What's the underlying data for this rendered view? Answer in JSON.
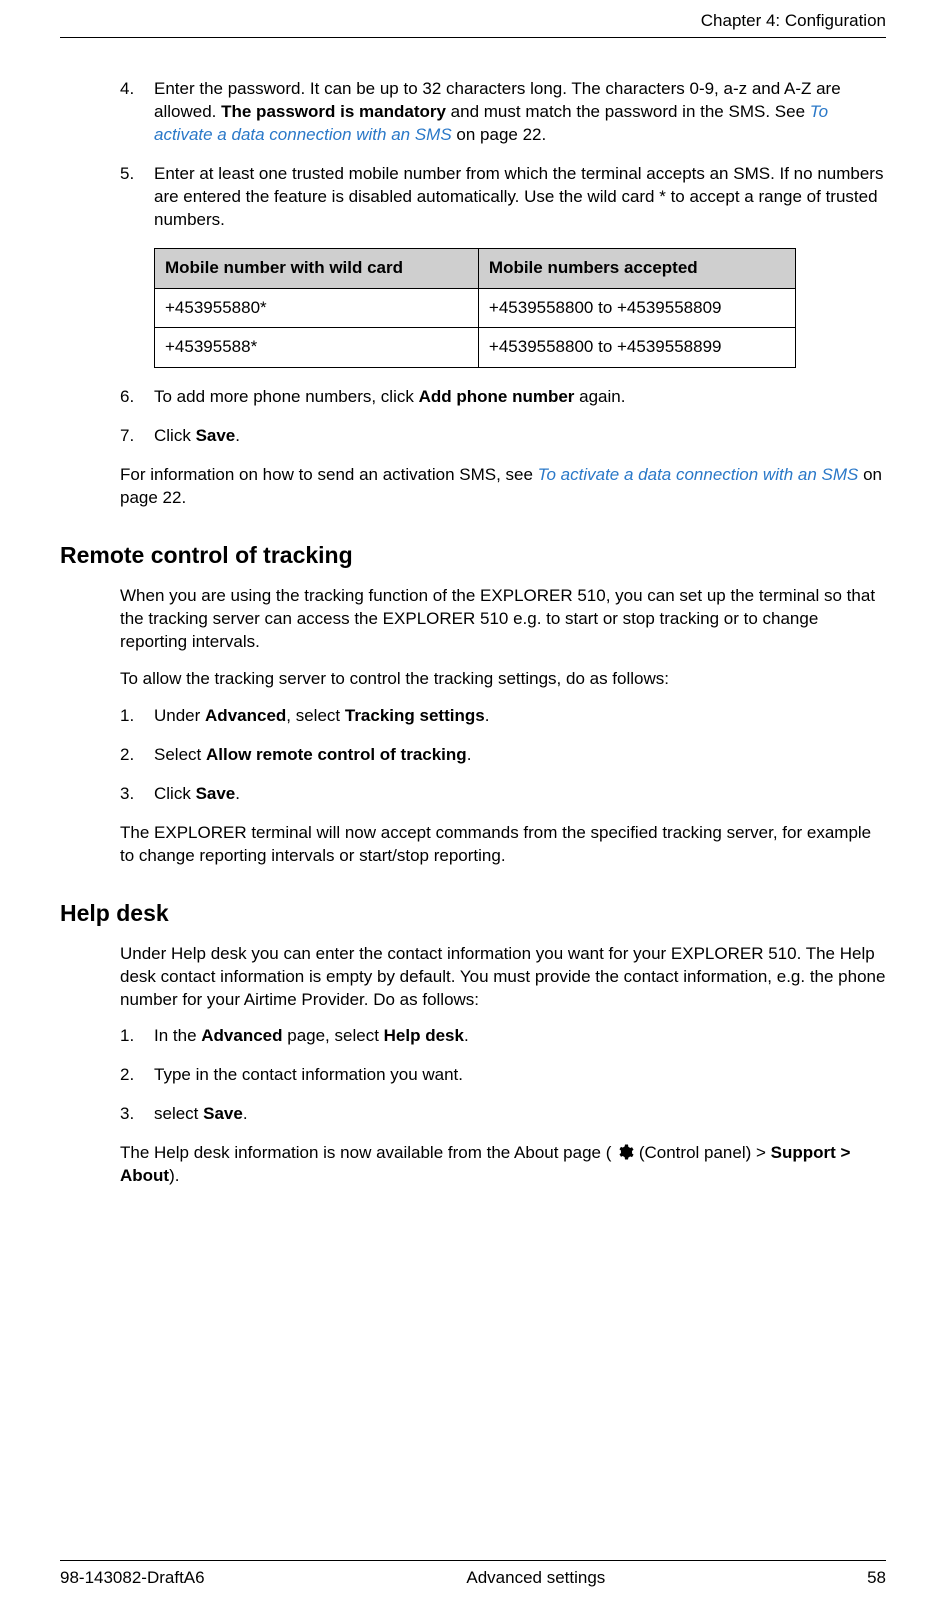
{
  "header": {
    "chapter": "Chapter 4: Configuration"
  },
  "steps_a": {
    "s4": {
      "num": "4.",
      "t1": "Enter the password. It can be up to 32 characters long. The characters 0-9, a-z and A-Z are allowed. ",
      "bold": "The password is mandatory",
      "t2": " and must match the password in the SMS. See ",
      "link": "To activate a data connection with an SMS",
      "t3": " on page 22."
    },
    "s5": {
      "num": "5.",
      "t1": "Enter at least one trusted mobile number from which the terminal accepts an SMS. If no numbers are entered the feature is disabled automatically. Use the wild card * to accept a range of trusted numbers."
    },
    "table": {
      "h1": "Mobile number with wild card",
      "h2": "Mobile numbers accepted",
      "r1c1": "+453955880*",
      "r1c2": "+4539558800 to +4539558809",
      "r2c1": "+45395588*",
      "r2c2": "+4539558800 to +4539558899"
    },
    "s6": {
      "num": "6.",
      "t1": "To add more phone numbers, click ",
      "bold": "Add phone number",
      "t2": " again."
    },
    "s7": {
      "num": "7.",
      "t1": "Click ",
      "bold": "Save",
      "t2": "."
    },
    "after": {
      "t1": "For information on how to send an activation SMS, see ",
      "link": "To activate a data connection with an SMS",
      "t2": " on page 22."
    }
  },
  "remote": {
    "heading": "Remote control of tracking",
    "p1": "When you are using the tracking function of the EXPLORER 510, you can set up the terminal so that the tracking server can access the EXPLORER 510 e.g. to start or stop tracking or to change reporting intervals.",
    "p2": "To allow the tracking server to control the tracking settings, do as follows:",
    "s1": {
      "num": "1.",
      "t1": "Under ",
      "b1": "Advanced",
      "t2": ", select ",
      "b2": "Tracking settings",
      "t3": "."
    },
    "s2": {
      "num": "2.",
      "t1": "Select ",
      "b1": "Allow remote control of tracking",
      "t2": "."
    },
    "s3": {
      "num": "3.",
      "t1": "Click ",
      "b1": "Save",
      "t2": "."
    },
    "p3": "The EXPLORER terminal will now accept commands from the specified tracking server, for example to change reporting intervals or start/stop reporting."
  },
  "helpdesk": {
    "heading": "Help desk",
    "p1": "Under Help desk you can enter the contact information you want for your EXPLORER 510. The Help desk contact information is empty by default. You must provide the contact information, e.g. the phone number for your Airtime Provider. Do as follows:",
    "s1": {
      "num": "1.",
      "t1": "In the ",
      "b1": "Advanced",
      "t2": " page, select ",
      "b2": "Help desk",
      "t3": "."
    },
    "s2": {
      "num": "2.",
      "t1": "Type in the contact information you want."
    },
    "s3": {
      "num": "3.",
      "t1": "select ",
      "b1": "Save",
      "t2": "."
    },
    "p2a": "The Help desk information is now available from the About page ( ",
    "p2b": " (Control panel) > ",
    "p2c": "Support > About",
    "p2d": ")."
  },
  "footer": {
    "left": "98-143082-DraftA6",
    "center": "Advanced settings",
    "right": "58"
  }
}
